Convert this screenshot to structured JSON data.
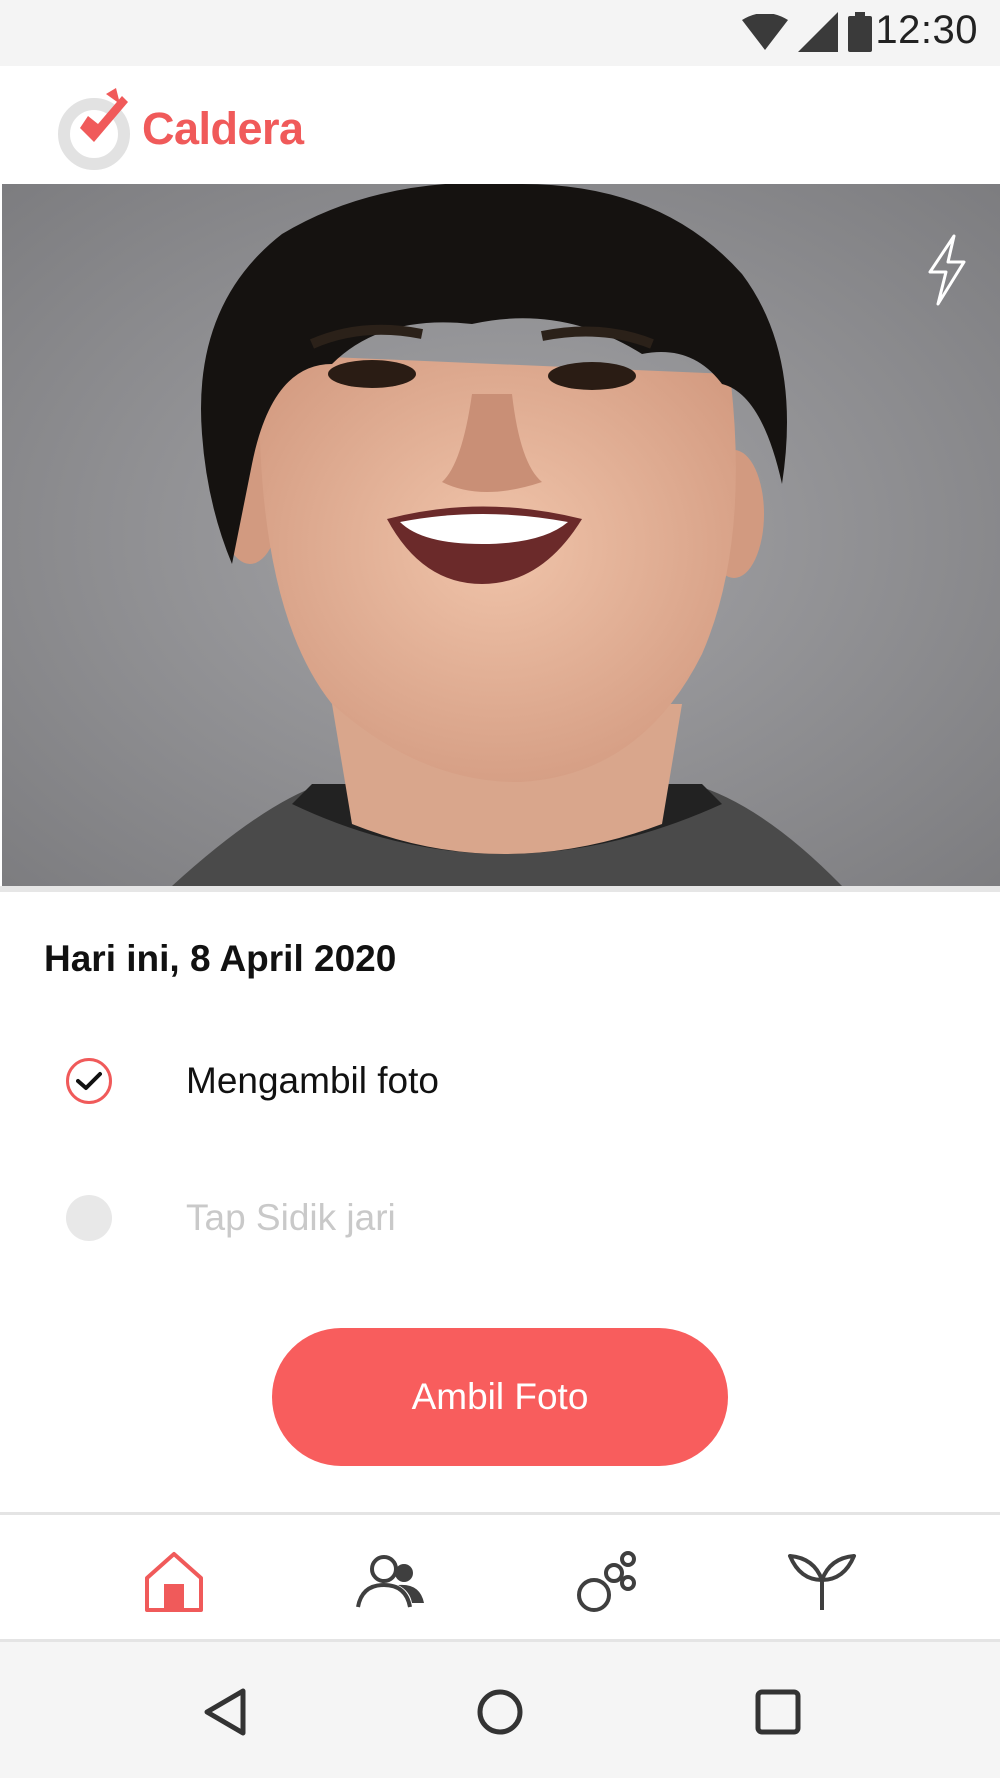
{
  "status_bar": {
    "time": "12:30"
  },
  "app": {
    "name": "Caldera",
    "brand_color": "#f05a5a"
  },
  "camera": {
    "flash_icon": "lightning-icon"
  },
  "attendance": {
    "date_label": "Hari ini, 8 April 2020",
    "steps": [
      {
        "label": "Mengambil foto",
        "state": "completed"
      },
      {
        "label": "Tap Sidik jari",
        "state": "pending"
      }
    ],
    "cta_label": "Ambil Foto"
  },
  "bottom_nav": {
    "active_color": "#f05a5a",
    "items": [
      {
        "icon": "home-icon",
        "active": true
      },
      {
        "icon": "people-icon",
        "active": false
      },
      {
        "icon": "bubbles-icon",
        "active": false
      },
      {
        "icon": "sprout-icon",
        "active": false
      }
    ]
  },
  "system_nav": {
    "items": [
      "back-icon",
      "home-circle-icon",
      "recents-icon"
    ]
  }
}
